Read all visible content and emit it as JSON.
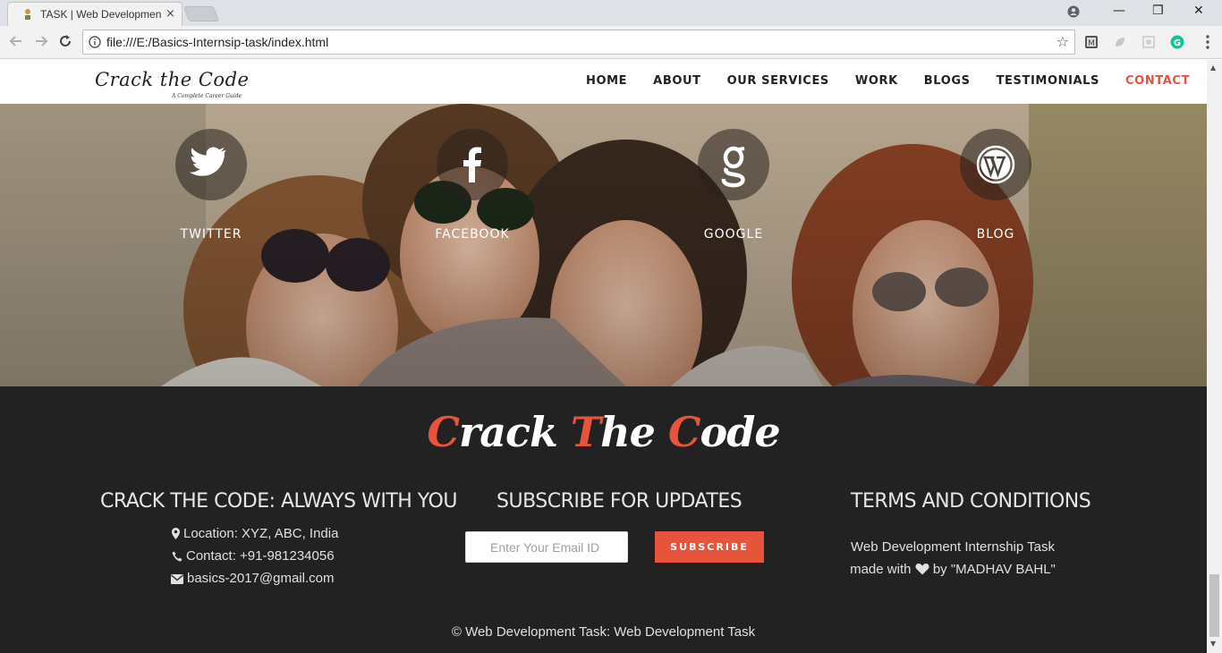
{
  "browser": {
    "tab_title": "TASK | Web Developmen",
    "tab_close": "×",
    "url": "file:///E:/Basics-Internsip-task/index.html",
    "window_controls": {
      "minimize": "—",
      "restore": "❐",
      "close": "✕"
    },
    "star": "☆"
  },
  "nav": {
    "logo_text": "Crack the Code",
    "logo_subtitle": "A Complete Career Guide",
    "items": [
      {
        "label": "HOME"
      },
      {
        "label": "ABOUT"
      },
      {
        "label": "OUR SERVICES"
      },
      {
        "label": "WORK"
      },
      {
        "label": "BLOGS"
      },
      {
        "label": "TESTIMONIALS"
      },
      {
        "label": "CONTACT"
      }
    ],
    "active_color": "#e8533c"
  },
  "social": [
    {
      "label": "TWITTER",
      "icon": "twitter-icon"
    },
    {
      "label": "FACEBOOK",
      "icon": "facebook-icon"
    },
    {
      "label": "GOOGLE",
      "icon": "google-icon"
    },
    {
      "label": "BLOG",
      "icon": "wordpress-icon"
    }
  ],
  "footer": {
    "brand": {
      "c1": "C",
      "p1": "rack ",
      "c2": "T",
      "p2": "he ",
      "c3": "C",
      "p3": "ode"
    },
    "contact": {
      "title": "CRACK THE CODE: ALWAYS WITH YOU",
      "location": "Location: XYZ, ABC, India",
      "phone": "Contact: +91-981234056",
      "email": "basics-2017@gmail.com"
    },
    "subscribe": {
      "title": "SUBSCRIBE FOR UPDATES",
      "placeholder": "Enter Your Email ID",
      "button": "SUBSCRIBE"
    },
    "terms": {
      "title": "TERMS AND CONDITIONS",
      "line1": "Web Development Internship Task",
      "line2_pre": "made with",
      "line2_post": "by \"MADHAV BAHL\""
    },
    "copyright": "© Web Development Task: Web Development Task"
  },
  "colors": {
    "accent": "#e8533c",
    "footer_bg": "#222222"
  }
}
